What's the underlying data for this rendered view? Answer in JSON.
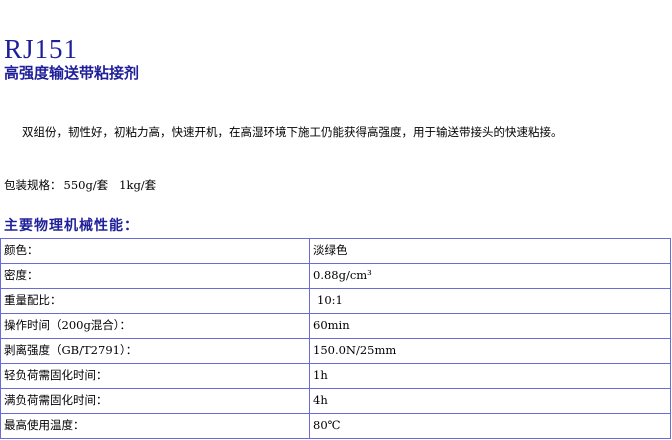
{
  "product": {
    "code": "RJ151",
    "name": "高强度输送带粘接剂"
  },
  "description": "双组份，韧性好，初粘力高，快速开机，在高湿环境下施工仍能获得高强度，用于输送带接头的快速粘接。",
  "packaging": {
    "label": "包装规格：",
    "value": "550g/套   1kg/套"
  },
  "properties": {
    "title": "主要物理机械性能：",
    "rows": [
      {
        "name": "颜色：",
        "value": "淡绿色"
      },
      {
        "name": "密度：",
        "value": "0.88g/cm³"
      },
      {
        "name": "重量配比：",
        "value": "10:1"
      },
      {
        "name": "操作时间（200g混合）：",
        "value": "60min"
      },
      {
        "name": "剥离强度（GB/T2791）：",
        "value": "150.0N/25mm"
      },
      {
        "name": "轻负荷需固化时间：",
        "value": "1h"
      },
      {
        "name": "满负荷需固化时间：",
        "value": "4h"
      },
      {
        "name": "最高使用温度：",
        "value": "80℃"
      }
    ]
  }
}
